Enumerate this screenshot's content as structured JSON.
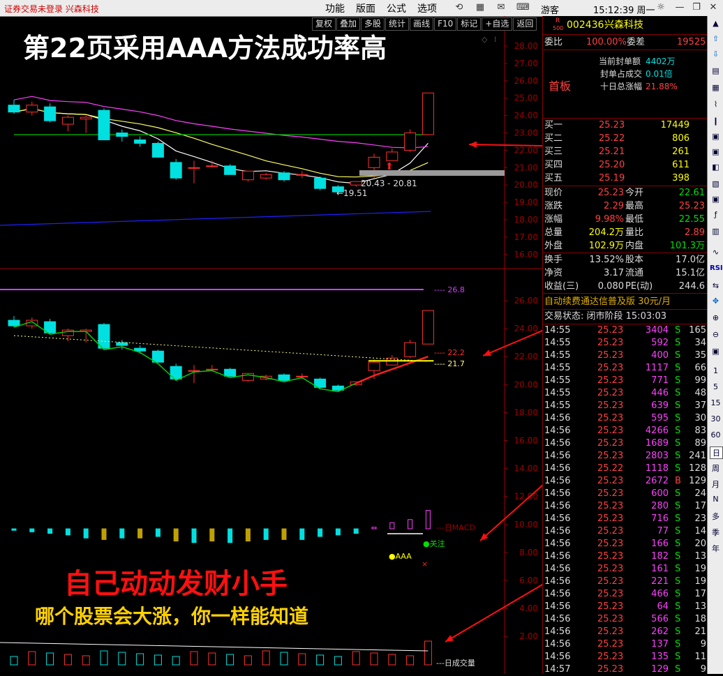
{
  "titlebar": {
    "status": "证券交易未登录  兴森科技",
    "menus": [
      "功能",
      "版面",
      "公式",
      "选项"
    ],
    "user": "游客",
    "clock": "15:12:39 周一"
  },
  "toolbar": [
    "复权",
    "叠加",
    "多股",
    "统计",
    "画线",
    "F10",
    "标记",
    "+自选",
    "返回"
  ],
  "overlay": {
    "title": "第22页采用AAA方法成功率高",
    "promo_line1": "自己动动发财小手",
    "promo_line2": "哪个股票会大涨，你一样能知道"
  },
  "chart_data": [
    {
      "type": "candlestick",
      "name": "main-kline",
      "y_axis_ticks": [
        "28.00",
        "27.00",
        "26.00",
        "25.00",
        "24.00",
        "23.00",
        "22.00",
        "21.00",
        "20.00",
        "19.00",
        "18.00",
        "17.00",
        "16.00"
      ],
      "ylim": [
        16.0,
        28.0
      ],
      "annotations": [
        "20.43 - 20.81",
        "19.51"
      ],
      "candles": [
        {
          "o": 24.6,
          "h": 24.9,
          "l": 24.1,
          "c": 24.2
        },
        {
          "o": 24.2,
          "h": 24.8,
          "l": 24.0,
          "c": 24.6
        },
        {
          "o": 24.5,
          "h": 24.7,
          "l": 23.6,
          "c": 23.7
        },
        {
          "o": 23.5,
          "h": 24.0,
          "l": 23.1,
          "c": 23.9
        },
        {
          "o": 23.8,
          "h": 24.0,
          "l": 23.0,
          "c": 23.9
        },
        {
          "o": 24.3,
          "h": 24.4,
          "l": 22.6,
          "c": 22.6
        },
        {
          "o": 23.0,
          "h": 23.2,
          "l": 22.5,
          "c": 22.8
        },
        {
          "o": 22.6,
          "h": 22.8,
          "l": 22.2,
          "c": 22.4
        },
        {
          "o": 22.4,
          "h": 22.5,
          "l": 21.6,
          "c": 21.6
        },
        {
          "o": 21.3,
          "h": 21.5,
          "l": 20.3,
          "c": 20.4
        },
        {
          "o": 21.0,
          "h": 21.4,
          "l": 20.1,
          "c": 21.0
        },
        {
          "o": 21.1,
          "h": 21.4,
          "l": 21.0,
          "c": 21.1
        },
        {
          "o": 21.1,
          "h": 21.2,
          "l": 20.6,
          "c": 20.6
        },
        {
          "o": 20.3,
          "h": 20.8,
          "l": 20.2,
          "c": 20.8
        },
        {
          "o": 20.4,
          "h": 20.7,
          "l": 20.3,
          "c": 20.6
        },
        {
          "o": 20.7,
          "h": 20.8,
          "l": 20.2,
          "c": 20.3
        },
        {
          "o": 20.6,
          "h": 20.8,
          "l": 20.4,
          "c": 20.6
        },
        {
          "o": 20.4,
          "h": 20.5,
          "l": 19.7,
          "c": 19.8
        },
        {
          "o": 19.9,
          "h": 20.0,
          "l": 19.5,
          "c": 19.6
        },
        {
          "o": 20.0,
          "h": 20.2,
          "l": 19.9,
          "c": 20.2
        },
        {
          "o": 21.0,
          "h": 21.8,
          "l": 20.4,
          "c": 21.6
        },
        {
          "o": 21.4,
          "h": 22.1,
          "l": 21.4,
          "c": 21.9
        },
        {
          "o": 22.0,
          "h": 23.2,
          "l": 21.9,
          "c": 23.0
        },
        {
          "o": 22.9,
          "h": 25.3,
          "l": 22.9,
          "c": 25.3
        }
      ]
    },
    {
      "type": "candlestick",
      "name": "secondary-kline",
      "y_axis_ticks": [
        "26.00",
        "24.00",
        "22.00",
        "20.00",
        "18.00",
        "16.00",
        "14.00",
        "12.00",
        "10.00",
        "8.00",
        "6.00",
        "4.00",
        "2.00"
      ],
      "ylim": [
        1.0,
        27.0
      ],
      "line_labels": [
        "26.8",
        "22.2",
        "21.7"
      ]
    },
    {
      "type": "bar",
      "name": "macd",
      "label": "---日MACD",
      "markers": [
        "关注",
        "AAA"
      ],
      "values": [
        -0.1,
        -0.2,
        -0.3,
        -0.4,
        -0.6,
        -0.7,
        -0.6,
        -0.6,
        -0.5,
        -0.8,
        -0.9,
        -0.8,
        -0.9,
        -0.8,
        -0.7,
        -0.7,
        -0.7,
        -0.5,
        -0.4,
        -0.3,
        0.1,
        0.4,
        0.6,
        1.2
      ]
    },
    {
      "type": "bar",
      "name": "volume",
      "label": "---日成交量"
    }
  ],
  "quote": {
    "code": "002436",
    "name": "兴森科技",
    "r_badge": "R",
    "r_sub": "500",
    "weibi_label": "委比",
    "weibi": "100.00%",
    "weicha_label": "委差",
    "weicha": "19525",
    "seal_amount_label": "当前封单额",
    "seal_amount": "4402万",
    "seal_ratio_label": "封单占成交",
    "seal_ratio": "0.01倍",
    "ten_day_label": "十日总涨幅",
    "ten_day": "21.88%",
    "first_board": "首板",
    "bids": [
      {
        "label": "买一",
        "price": "25.23",
        "vol": "17449"
      },
      {
        "label": "买二",
        "price": "25.22",
        "vol": "806"
      },
      {
        "label": "买三",
        "price": "25.21",
        "vol": "261"
      },
      {
        "label": "买四",
        "price": "25.20",
        "vol": "611"
      },
      {
        "label": "买五",
        "price": "25.19",
        "vol": "398"
      }
    ],
    "stats": [
      {
        "l1": "现价",
        "v1": "25.23",
        "l2": "今开",
        "v2": "22.61"
      },
      {
        "l1": "涨跌",
        "v1": "2.29",
        "l2": "最高",
        "v2": "25.23"
      },
      {
        "l1": "涨幅",
        "v1": "9.98%",
        "l2": "最低",
        "v2": "22.55"
      },
      {
        "l1": "总量",
        "v1": "204.2万",
        "l2": "量比",
        "v2": "2.89"
      },
      {
        "l1": "外盘",
        "v1": "102.9万",
        "l2": "内盘",
        "v2": "101.3万"
      }
    ],
    "stats2": [
      {
        "l1": "换手",
        "v1": "13.52%",
        "l2": "股本",
        "v2": "17.0亿"
      },
      {
        "l1": "净资",
        "v1": "3.17",
        "l2": "流通",
        "v2": "15.1亿"
      },
      {
        "l1": "收益(三)",
        "v1": "0.080",
        "l2": "PE(动)",
        "v2": "244.6"
      }
    ],
    "ad_text": "自动续费通达信普及版  30元/月",
    "trade_state": "交易状态: 闭市阶段 15:03:03"
  },
  "ticks": [
    {
      "t": "14:55",
      "p": "25.23",
      "v": "3404",
      "d": "S",
      "n": "165"
    },
    {
      "t": "14:55",
      "p": "25.23",
      "v": "592",
      "d": "S",
      "n": "34"
    },
    {
      "t": "14:55",
      "p": "25.23",
      "v": "400",
      "d": "S",
      "n": "35"
    },
    {
      "t": "14:55",
      "p": "25.23",
      "v": "1117",
      "d": "S",
      "n": "66"
    },
    {
      "t": "14:55",
      "p": "25.23",
      "v": "771",
      "d": "S",
      "n": "99"
    },
    {
      "t": "14:55",
      "p": "25.23",
      "v": "446",
      "d": "S",
      "n": "48"
    },
    {
      "t": "14:55",
      "p": "25.23",
      "v": "639",
      "d": "S",
      "n": "37"
    },
    {
      "t": "14:56",
      "p": "25.23",
      "v": "595",
      "d": "S",
      "n": "30"
    },
    {
      "t": "14:56",
      "p": "25.23",
      "v": "4266",
      "d": "S",
      "n": "83"
    },
    {
      "t": "14:56",
      "p": "25.23",
      "v": "1689",
      "d": "S",
      "n": "89"
    },
    {
      "t": "14:56",
      "p": "25.23",
      "v": "2803",
      "d": "S",
      "n": "241"
    },
    {
      "t": "14:56",
      "p": "25.22",
      "v": "1118",
      "d": "S",
      "n": "128"
    },
    {
      "t": "14:56",
      "p": "25.23",
      "v": "2672",
      "d": "B",
      "n": "129"
    },
    {
      "t": "14:56",
      "p": "25.23",
      "v": "600",
      "d": "S",
      "n": "24"
    },
    {
      "t": "14:56",
      "p": "25.23",
      "v": "280",
      "d": "S",
      "n": "17"
    },
    {
      "t": "14:56",
      "p": "25.23",
      "v": "716",
      "d": "S",
      "n": "23"
    },
    {
      "t": "14:56",
      "p": "25.23",
      "v": "77",
      "d": "S",
      "n": "14"
    },
    {
      "t": "14:56",
      "p": "25.23",
      "v": "166",
      "d": "S",
      "n": "20"
    },
    {
      "t": "14:56",
      "p": "25.23",
      "v": "182",
      "d": "S",
      "n": "13"
    },
    {
      "t": "14:56",
      "p": "25.23",
      "v": "161",
      "d": "S",
      "n": "19"
    },
    {
      "t": "14:56",
      "p": "25.23",
      "v": "221",
      "d": "S",
      "n": "19"
    },
    {
      "t": "14:56",
      "p": "25.23",
      "v": "466",
      "d": "S",
      "n": "17"
    },
    {
      "t": "14:56",
      "p": "25.23",
      "v": "64",
      "d": "S",
      "n": "13"
    },
    {
      "t": "14:56",
      "p": "25.23",
      "v": "566",
      "d": "S",
      "n": "18"
    },
    {
      "t": "14:56",
      "p": "25.23",
      "v": "262",
      "d": "S",
      "n": "21"
    },
    {
      "t": "14:56",
      "p": "25.23",
      "v": "137",
      "d": "S",
      "n": "9"
    },
    {
      "t": "14:56",
      "p": "25.23",
      "v": "135",
      "d": "S",
      "n": "11"
    },
    {
      "t": "14:57",
      "p": "25.23",
      "v": "129",
      "d": "S",
      "n": "9"
    }
  ],
  "sidebar_tabs": [
    "1",
    "5",
    "15",
    "30",
    "60",
    "日",
    "周",
    "月",
    "N",
    "多",
    "季",
    "年"
  ],
  "colors": {
    "up": "#ff3030",
    "down": "#00e0e0",
    "grid": "#800000",
    "ma5": "#ffffff",
    "ma10": "#ffff60",
    "ma20": "#ff40ff",
    "ma60": "#00c000",
    "ma120": "#2020ff"
  }
}
